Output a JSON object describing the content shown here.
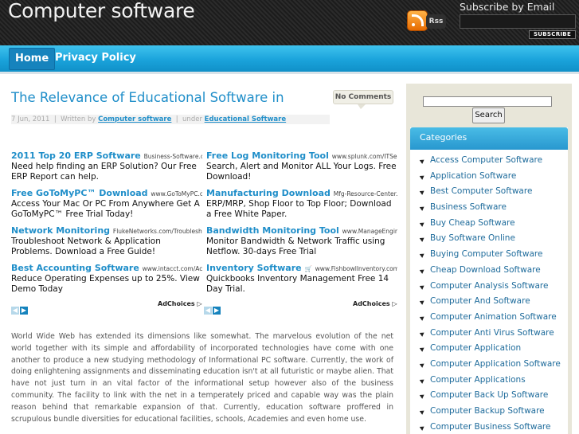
{
  "header": {
    "site_title": "Computer software",
    "rss_label": "Rss",
    "subscribe_title": "Subscribe by Email",
    "subscribe_button": "SUBSCRIBE"
  },
  "nav": {
    "items": [
      {
        "label": "Home",
        "active": true
      },
      {
        "label": "Privacy Policy",
        "active": false
      }
    ]
  },
  "post": {
    "title": "The Relevance of Educational Software in",
    "comments_badge": "No Comments",
    "meta": {
      "date": "7 Jun, 2011",
      "written_by_label": "Written by",
      "author": "Computer software",
      "under_label": "under",
      "category": "Educational Software"
    },
    "body": "World Wide Web has extended its dimensions like somewhat. The marvelous evolution of the net world together with its simple and affordability of incorporated technologies have come with one another to produce a new studying methodology of Informational PC software. Currently, the work of doing enlightening assignments and disseminating education isn't at all futuristic or maybe alien. That have not just turn in an vital factor of the informational setup however also of the business community. The facility to link with the net in a temperately priced and capable way was the plain reason behind that remarkable expansion of that. Currently, education software proffered in scrupulous bundle diversities for educational facilities, schools, Academies and even home use."
  },
  "ads": {
    "left": [
      {
        "title": "2011 Top 20 ERP Software",
        "source": "Business-Software.c...",
        "desc": "Need help finding an ERP Solution? Our Free ERP Report can help."
      },
      {
        "title": "Free GoToMyPC™ Download",
        "source": "www.GoToMyPC.c...",
        "desc": "Access Your Mac Or PC From Anywhere Get A GoToMyPC™ Free Trial Today!"
      },
      {
        "title": "Network Monitoring",
        "source": "FlukeNetworks.com/Troublesho...",
        "desc": "Troubleshoot Network & Application Problems. Download a Free Guide!"
      },
      {
        "title": "Best Accounting Software",
        "source": "www.intacct.com/Acc...",
        "desc": "Reduce Operating Expenses up to 25%. View Demo Today"
      }
    ],
    "right": [
      {
        "title": "Free Log Monitoring Tool",
        "source": "www.splunk.com/ITSea...",
        "desc": "Search, Alert and Monitor ALL Your Logs. Free Download!"
      },
      {
        "title": "Manufacturing Download",
        "source": "Mfg-Resource-Center....",
        "desc": "ERP/MRP, Shop Floor to Top Floor; Download a Free White Paper."
      },
      {
        "title": "Bandwidth Monitoring Tool",
        "source": "www.ManageEngine....",
        "desc": "Monitor Bandwidth & Network Traffic using Netflow. 30-days Free Trial"
      },
      {
        "title": "Inventory Software",
        "source": "www.FishbowlInventory.com",
        "desc": "Quickbooks Inventory Management Free 14 Day Trial."
      }
    ],
    "adchoices_label": "AdChoices"
  },
  "sidebar": {
    "search_button": "Search",
    "categories_title": "Categories",
    "categories": [
      "Access Computer Software",
      "Application Software",
      "Best Computer Software",
      "Business Software",
      "Buy Cheap Software",
      "Buy Software Online",
      "Buying Computer Software",
      "Cheap Download Software",
      "Computer Analysis Software",
      "Computer And Software",
      "Computer Animation Software",
      "Computer Anti Virus Software",
      "Computer Application",
      "Computer Application Software",
      "Computer Applications",
      "Computer Back Up Software",
      "Computer Backup Software",
      "Computer Business Software"
    ]
  },
  "colors": {
    "accent": "#1f8ec9",
    "nav_blue": "#1aa3db",
    "sidebar_bg": "#e8e6d9"
  }
}
